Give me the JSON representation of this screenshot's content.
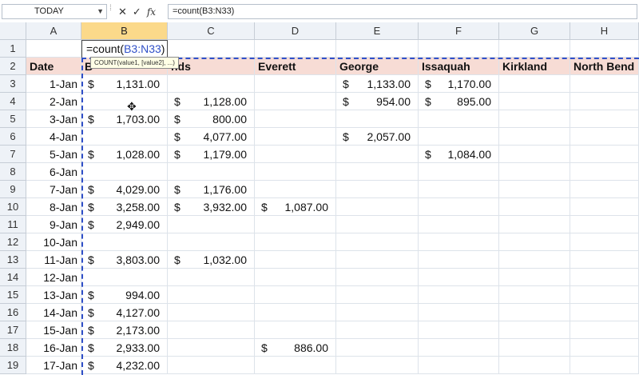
{
  "formula_bar": {
    "name_box": "TODAY",
    "cancel_glyph": "✕",
    "enter_glyph": "✓",
    "fx_label": "fx",
    "formula": "=count(B3:N33)"
  },
  "columns": [
    "A",
    "B",
    "C",
    "D",
    "E",
    "F",
    "G",
    "H"
  ],
  "rows": [
    "1",
    "2",
    "3",
    "4",
    "5",
    "6",
    "7",
    "8",
    "9",
    "10",
    "11",
    "12",
    "13",
    "14",
    "15",
    "16",
    "17",
    "18",
    "19"
  ],
  "edit_cell": {
    "prefix": "=count(",
    "ref": "B3:N33",
    "suffix": ")"
  },
  "tooltip": "COUNT(value1, [value2], ...)",
  "headers": {
    "A": "Date",
    "B": "B",
    "C": "nds",
    "D": "Everett",
    "E": "George",
    "F": "Issaquah",
    "G": "Kirkland",
    "H": "North Bend"
  },
  "currency_symbol": "$",
  "dates": [
    "1-Jan",
    "2-Jan",
    "3-Jan",
    "4-Jan",
    "5-Jan",
    "6-Jan",
    "7-Jan",
    "8-Jan",
    "9-Jan",
    "10-Jan",
    "11-Jan",
    "12-Jan",
    "13-Jan",
    "14-Jan",
    "15-Jan",
    "16-Jan",
    "17-Jan"
  ],
  "table": {
    "B": [
      "1,131.00",
      "",
      "1,703.00",
      "",
      "1,028.00",
      "",
      "4,029.00",
      "3,258.00",
      "2,949.00",
      "",
      "3,803.00",
      "",
      "994.00",
      "4,127.00",
      "2,173.00",
      "2,933.00",
      "4,232.00"
    ],
    "C": [
      "",
      "1,128.00",
      "800.00",
      "4,077.00",
      "1,179.00",
      "",
      "1,176.00",
      "3,932.00",
      "",
      "",
      "1,032.00",
      "",
      "",
      "",
      "",
      "",
      ""
    ],
    "D": [
      "",
      "",
      "",
      "",
      "",
      "",
      "",
      "1,087.00",
      "",
      "",
      "",
      "",
      "",
      "",
      "",
      "886.00",
      ""
    ],
    "E": [
      "1,133.00",
      "954.00",
      "",
      "2,057.00",
      "",
      "",
      "",
      "",
      "",
      "",
      "",
      "",
      "",
      "",
      "",
      "",
      ""
    ],
    "F": [
      "1,170.00",
      "895.00",
      "",
      "",
      "1,084.00",
      "",
      "",
      "",
      "",
      "",
      "",
      "",
      "",
      "",
      "",
      "",
      ""
    ]
  }
}
